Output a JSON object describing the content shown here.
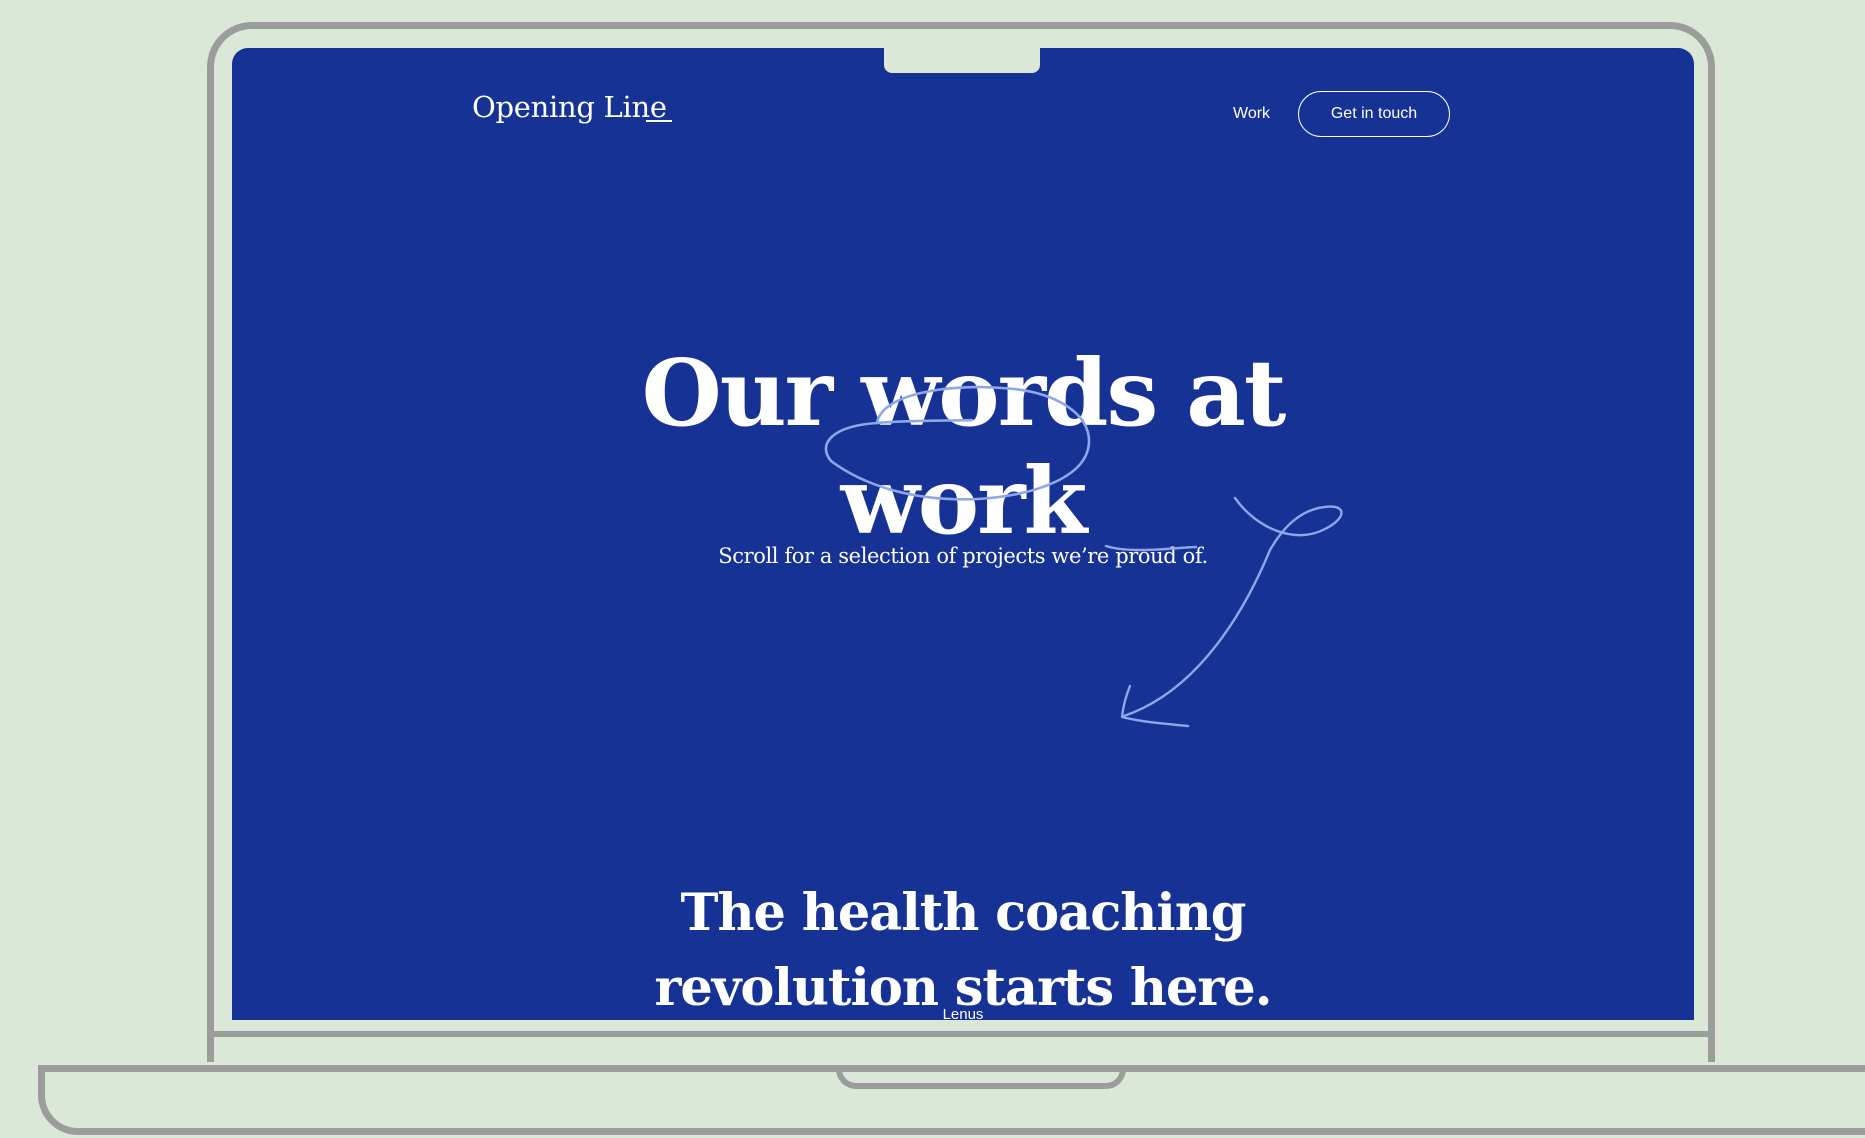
{
  "header": {
    "logo": "Opening Line",
    "nav": {
      "work_label": "Work",
      "cta_label": "Get in touch"
    }
  },
  "hero": {
    "title_line1": "Our words at",
    "title_line2": "work",
    "subtitle_before": "Scroll for a selection of projects we’re ",
    "subtitle_highlight": "proud",
    "subtitle_after": " of."
  },
  "project": {
    "title_line1": "The health coaching",
    "title_line2": "revolution starts here.",
    "client": "Lenus"
  },
  "colors": {
    "page_background": "#dbe8d8",
    "screen_background": "#163295",
    "text": "#ffffff",
    "sketch_stroke": "#8fa6e8",
    "device_frame": "#9b9d9b"
  },
  "icons": {
    "hero_circle": "hand-drawn-circle",
    "subtitle_underline": "hand-drawn-underline",
    "scroll_arrow": "hand-drawn-arrow-down-left"
  }
}
